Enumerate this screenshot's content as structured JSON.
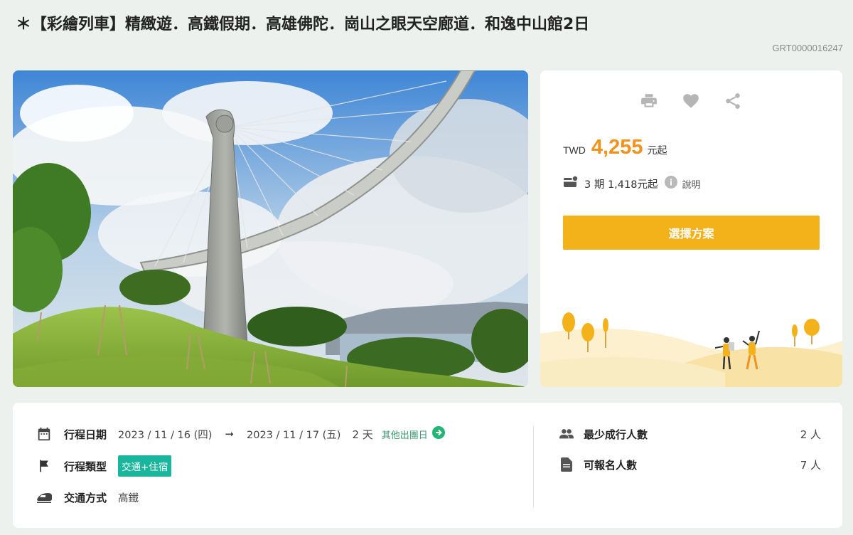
{
  "product": {
    "title": "＊【彩繪列車】精緻遊．高鐵假期．高雄佛陀．崗山之眼天空廊道．和逸中山館2日",
    "code": "GRT0000016247"
  },
  "actions": [
    {
      "name": "print-icon"
    },
    {
      "name": "heart-icon"
    },
    {
      "name": "share-icon"
    }
  ],
  "pricing": {
    "currency": "TWD",
    "amount": "4,255",
    "suffix": "元起",
    "installment_text": "3 期 1,418元起",
    "explain_label": "說明",
    "choose_button": "選擇方案"
  },
  "trip": {
    "date_label": "行程日期",
    "start_date": "2023 / 11 / 16 (四)",
    "end_date": "2023 / 11 / 17 (五)",
    "duration": "2 天",
    "other_dates_label": "其他出團日",
    "type_label": "行程類型",
    "type_badge": "交通+住宿",
    "transport_label": "交通方式",
    "transport_value": "高鐵"
  },
  "group": {
    "min_label": "最少成行人數",
    "min_value": "2 人",
    "available_label": "可報名人數",
    "available_value": "7 人"
  },
  "colors": {
    "accent_orange": "#f0921e",
    "button_yellow": "#f3b21a",
    "badge_teal": "#19b69d",
    "link_green": "#3a9a6e",
    "background": "#ecf1ee"
  }
}
